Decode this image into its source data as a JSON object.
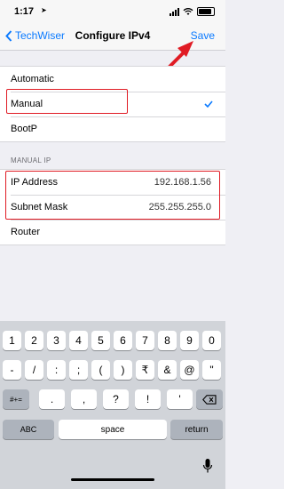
{
  "status": {
    "time": "1:17",
    "location_arrow": "location-arrow-icon"
  },
  "nav": {
    "back_label": "TechWiser",
    "title": "Configure IPv4",
    "save_label": "Save"
  },
  "modes": [
    {
      "label": "Automatic",
      "selected": false
    },
    {
      "label": "Manual",
      "selected": true
    },
    {
      "label": "BootP",
      "selected": false
    }
  ],
  "manual_ip": {
    "header": "MANUAL IP",
    "ip_label": "IP Address",
    "ip_value": "192.168.1.56",
    "mask_label": "Subnet Mask",
    "mask_value": "255.255.255.0",
    "router_label": "Router"
  },
  "keyboard": {
    "row1": [
      "1",
      "2",
      "3",
      "4",
      "5",
      "6",
      "7",
      "8",
      "9",
      "0"
    ],
    "row2": [
      "-",
      "/",
      ":",
      ";",
      "(",
      ")",
      "₹",
      "&",
      "@",
      "\""
    ],
    "row3_left": "#+=",
    "row3_mid": [
      ".",
      ",",
      "?",
      "!",
      "'"
    ],
    "row3_right": "backspace-icon",
    "abc": "ABC",
    "space": "space",
    "return": "return"
  },
  "colors": {
    "accent": "#0a7aff",
    "annotation": "#e01b24"
  }
}
